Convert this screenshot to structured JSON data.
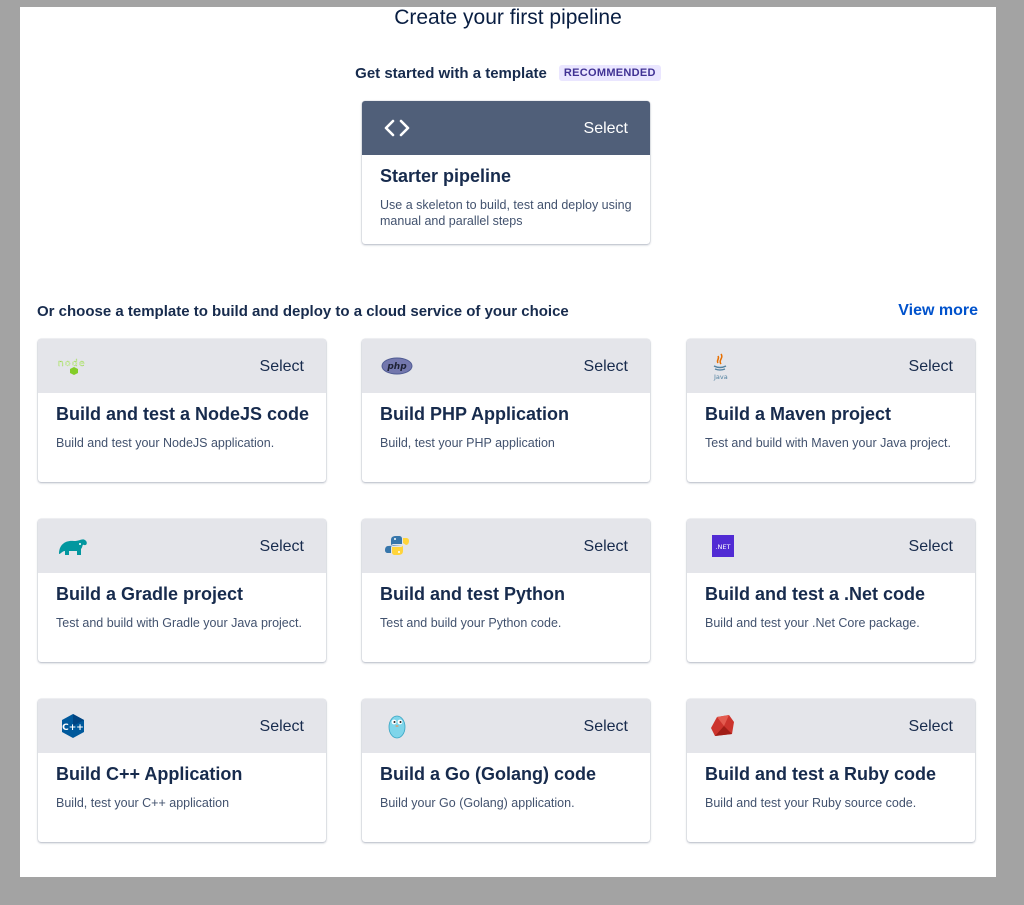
{
  "page_title": "Create your first pipeline",
  "recommended": {
    "heading": "Get started with a template",
    "badge": "RECOMMENDED",
    "card": {
      "icon": "code-brackets-icon",
      "select_label": "Select",
      "title": "Starter pipeline",
      "description": "Use a skeleton to build, test and deploy using manual and parallel steps"
    }
  },
  "cloud": {
    "heading": "Or choose a template to build and deploy to a cloud service of your choice",
    "view_more": "View more",
    "cards": [
      {
        "icon": "nodejs-icon",
        "select_label": "Select",
        "title": "Build and test a NodeJS code",
        "description": "Build and test your NodeJS application."
      },
      {
        "icon": "php-icon",
        "select_label": "Select",
        "title": "Build PHP Application",
        "description": "Build, test your PHP application"
      },
      {
        "icon": "java-icon",
        "icon_text": "Java",
        "select_label": "Select",
        "title": "Build a Maven project",
        "description": "Test and build with Maven your Java project."
      },
      {
        "icon": "gradle-elephant-icon",
        "select_label": "Select",
        "title": "Build a Gradle project",
        "description": "Test and build with Gradle your Java project."
      },
      {
        "icon": "python-icon",
        "select_label": "Select",
        "title": "Build and test Python",
        "description": "Test and build your Python code."
      },
      {
        "icon": "dotnet-icon",
        "icon_text": ".NET",
        "select_label": "Select",
        "title": "Build and test a .Net code",
        "description": "Build and test your .Net Core package."
      },
      {
        "icon": "cpp-icon",
        "icon_text": "C++",
        "select_label": "Select",
        "title": "Build C++ Application",
        "description": "Build, test your C++ application"
      },
      {
        "icon": "golang-gopher-icon",
        "select_label": "Select",
        "title": "Build a Go (Golang) code",
        "description": "Build your Go (Golang) application."
      },
      {
        "icon": "ruby-icon",
        "select_label": "Select",
        "title": "Build and test a Ruby code",
        "description": "Build and test your Ruby source code."
      }
    ]
  },
  "colors": {
    "header_dark": "#505f79",
    "header_light": "#e4e5ea",
    "link": "#0052cc",
    "badge_bg": "#eae6ff",
    "badge_text": "#403294"
  }
}
